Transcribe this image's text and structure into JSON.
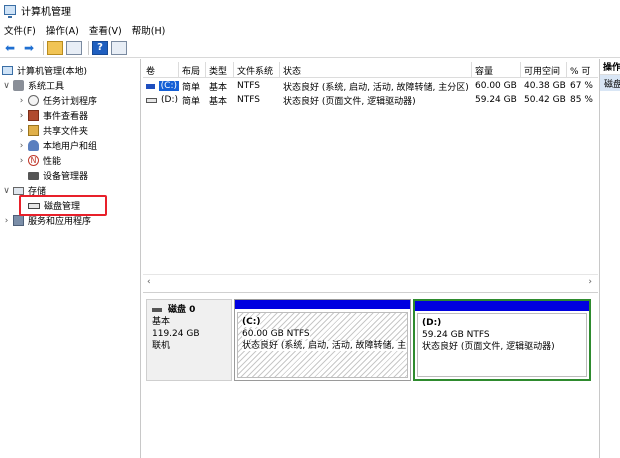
{
  "window": {
    "title": "计算机管理"
  },
  "menu": [
    "文件(F)",
    "操作(A)",
    "查看(V)",
    "帮助(H)"
  ],
  "tree": {
    "root": "计算机管理(本地)",
    "system_tools": "系统工具",
    "task_scheduler": "任务计划程序",
    "event_viewer": "事件查看器",
    "shared_folders": "共享文件夹",
    "local_users": "本地用户和组",
    "performance": "性能",
    "device_manager": "设备管理器",
    "storage": "存储",
    "disk_management": "磁盘管理",
    "services_apps": "服务和应用程序"
  },
  "volume_table": {
    "headers": [
      "卷",
      "布局",
      "类型",
      "文件系统",
      "状态",
      "容量",
      "可用空间",
      "% 可"
    ],
    "rows": [
      {
        "volume": "(C:)",
        "layout": "简单",
        "type": "基本",
        "fs": "NTFS",
        "status": "状态良好 (系统, 启动, 活动, 故障转储, 主分区)",
        "capacity": "60.00 GB",
        "free": "40.38 GB",
        "pct": "67 %"
      },
      {
        "volume": "(D:)",
        "layout": "简单",
        "type": "基本",
        "fs": "NTFS",
        "status": "状态良好 (页面文件, 逻辑驱动器)",
        "capacity": "59.24 GB",
        "free": "50.42 GB",
        "pct": "85 %"
      }
    ]
  },
  "disk": {
    "name": "磁盘 0",
    "type": "基本",
    "size": "119.24 GB",
    "state": "联机",
    "partitions": [
      {
        "label": "(C:)",
        "size": "60.00 GB NTFS",
        "status": "状态良好 (系统, 启动, 活动, 故障转储, 主分"
      },
      {
        "label": "(D:)",
        "size": "59.24 GB NTFS",
        "status": "状态良好 (页面文件, 逻辑驱动器)"
      }
    ]
  },
  "actions": {
    "header": "操作",
    "item": "磁盘"
  },
  "colors": {
    "selection": "#1560d6",
    "partition_bar": "#0000e0",
    "highlight_box": "#e8202a",
    "selected_partition_border": "#2e8b2e"
  }
}
